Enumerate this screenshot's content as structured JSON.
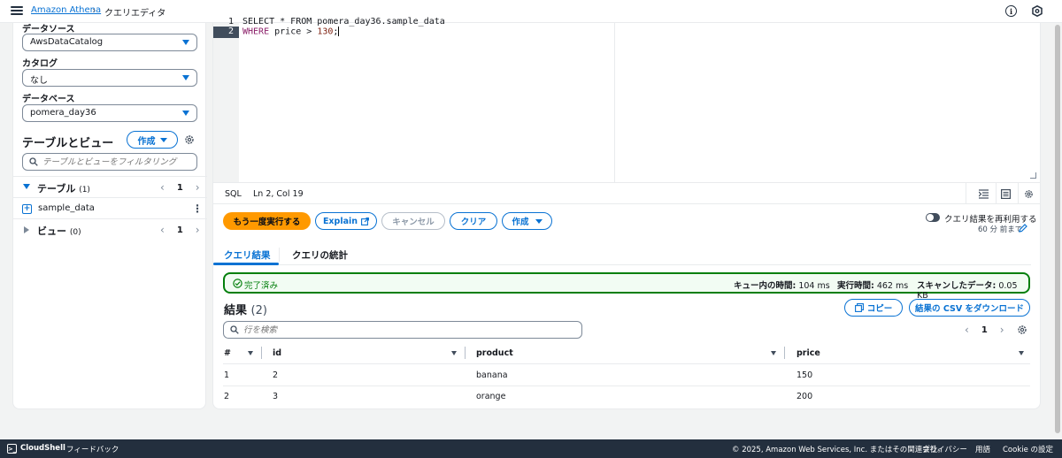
{
  "header": {
    "breadcrumb_link": "Amazon Athena",
    "breadcrumb_current": "クエリエディタ"
  },
  "sidebar": {
    "datasource_label": "データソース",
    "datasource_value": "AwsDataCatalog",
    "catalog_label": "カタログ",
    "catalog_value": "なし",
    "database_label": "データベース",
    "database_value": "pomera_day36",
    "heading": "テーブルとビュー",
    "create_label": "作成",
    "filter_placeholder": "テーブルとビューをフィルタリング",
    "tables_label": "テーブル",
    "tables_count": "(1)",
    "tables_page": "1",
    "table_item": "sample_data",
    "views_label": "ビュー",
    "views_count": "(0)",
    "views_page": "1"
  },
  "editor": {
    "line1_number": "1",
    "line1_text": "SELECT * FROM pomera_day36.sample_data",
    "line2_number": "2",
    "line2_kw": "WHERE",
    "line2_field": " price ",
    "line2_op": ">",
    "line2_num": "130",
    "line2_end": ";",
    "language": "SQL",
    "position": "Ln 2, Col 19"
  },
  "actions": {
    "rerun": "もう一度実行する",
    "explain": "Explain",
    "cancel": "キャンセル",
    "clear": "クリア",
    "create": "作成",
    "reuse_label": "クエリ結果を再利用する",
    "reuse_sub": "60 分 前まで"
  },
  "tabs": {
    "results": "クエリ結果",
    "stats": "クエリの統計"
  },
  "status": {
    "state": "完了済み",
    "queue_label": "キュー内の時間:",
    "queue_value": "104 ms",
    "exec_label": "実行時間:",
    "exec_value": "462 ms",
    "scanned_label": "スキャンしたデータ:",
    "scanned_value": "0.05 KB"
  },
  "results": {
    "title": "結果",
    "count": "(2)",
    "copy_label": "コピー",
    "download_label": "結果の CSV をダウンロード",
    "search_placeholder": "行を検索",
    "page": "1",
    "columns": [
      "#",
      "id",
      "product",
      "price"
    ],
    "rows": [
      [
        "1",
        "2",
        "banana",
        "150"
      ],
      [
        "2",
        "3",
        "orange",
        "200"
      ]
    ]
  },
  "footer": {
    "cloudshell": "CloudShell",
    "feedback": "フィードバック",
    "copyright": "© 2025, Amazon Web Services, Inc. またはその関連会社。",
    "privacy": "プライバシー",
    "terms": "用語",
    "cookie": "Cookie の設定"
  },
  "colors": {
    "accent": "#0972d3",
    "primary_button": "#ff9900",
    "success": "#037f0c",
    "footer_bg": "#232f3e"
  }
}
